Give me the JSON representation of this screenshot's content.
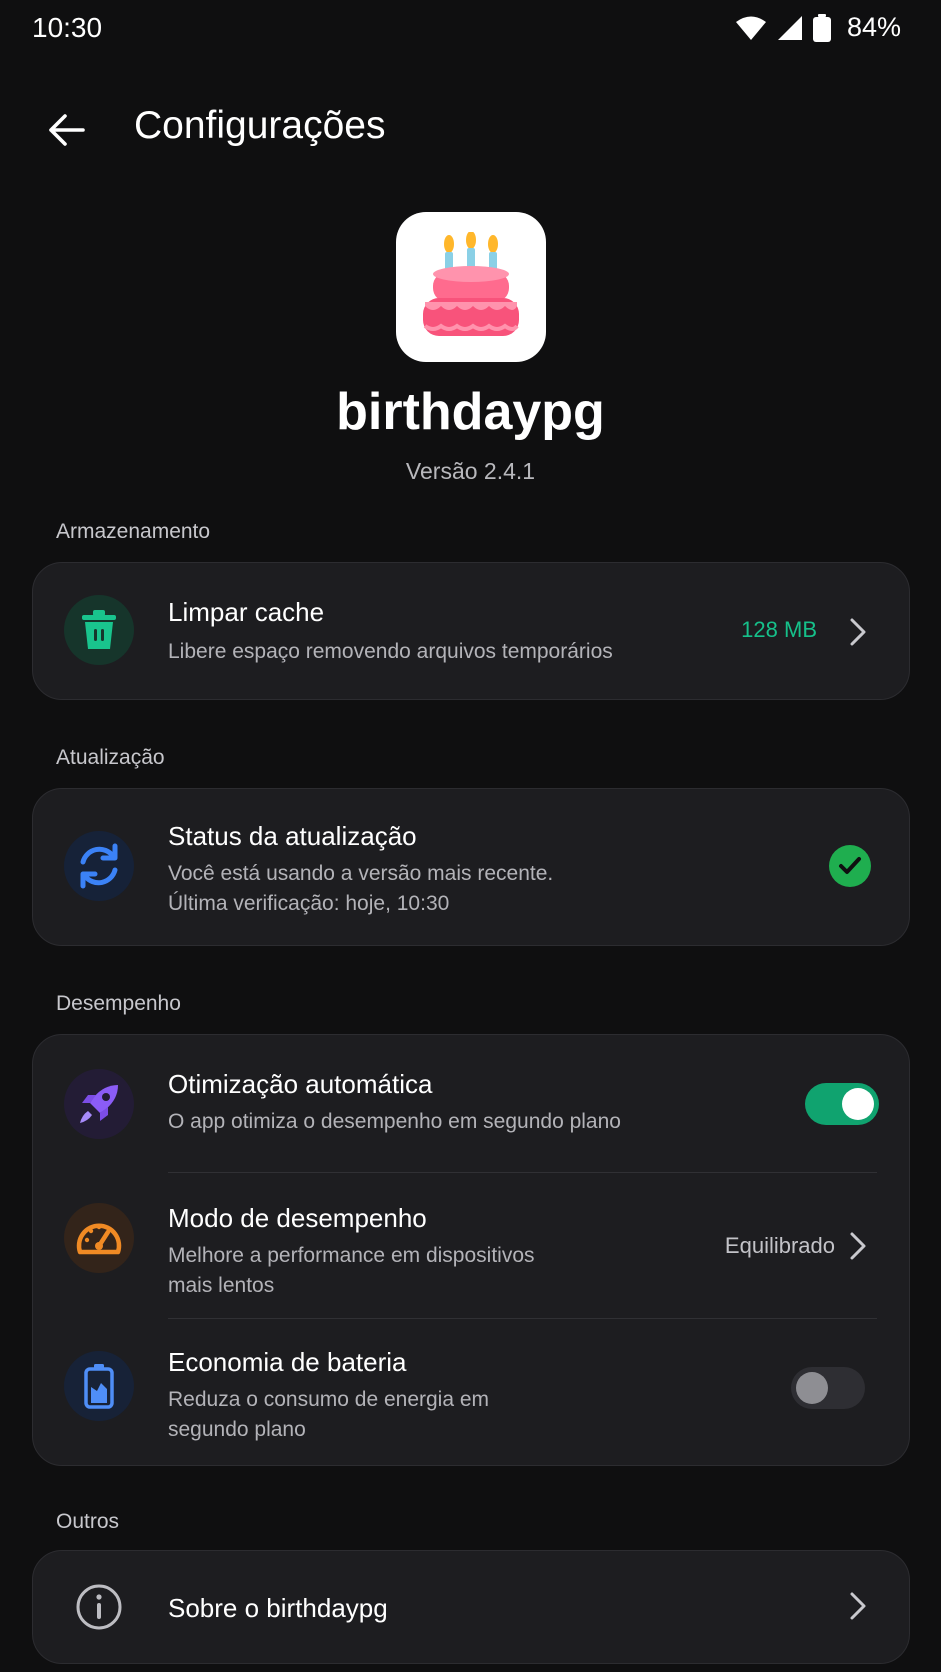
{
  "status_bar": {
    "time": "10:30",
    "battery": "84%"
  },
  "header": {
    "title": "Configurações"
  },
  "app": {
    "name": "birthdaypg",
    "version": "Versão 2.4.1"
  },
  "sections": {
    "storage": {
      "label": "Armazenamento",
      "clear_cache": {
        "title": "Limpar cache",
        "subtitle": "Libere espaço removendo arquivos temporários",
        "value": "128 MB"
      }
    },
    "update": {
      "label": "Atualização",
      "status": {
        "title": "Status da atualização",
        "line1": "Você está usando a versão mais recente.",
        "line2": "Última verificação: hoje, 10:30"
      }
    },
    "performance": {
      "label": "Desempenho",
      "auto_opt": {
        "title": "Otimização automática",
        "subtitle": "O app otimiza o desempenho em segundo plano",
        "enabled": true
      },
      "mode": {
        "title": "Modo de desempenho",
        "line1": "Melhore a performance em dispositivos",
        "line2": "mais lentos",
        "value": "Equilibrado"
      },
      "battery": {
        "title": "Economia de bateria",
        "line1": "Reduza o consumo de energia em",
        "line2": "segundo plano",
        "enabled": false
      }
    },
    "others": {
      "label": "Outros",
      "about": {
        "title": "Sobre o birthdaypg"
      }
    }
  },
  "colors": {
    "accent_green": "#16c08a",
    "toggle_on": "#10a36f",
    "check_green": "#1fae4f",
    "update_blue": "#3b82f6",
    "rocket_purple": "#8b5cf6",
    "gauge_orange": "#f08a24",
    "battery_blue": "#4f8ef7"
  },
  "icons": [
    "back-arrow-icon",
    "trash-icon",
    "sync-icon",
    "check-icon",
    "rocket-icon",
    "speedometer-icon",
    "battery-icon",
    "info-icon",
    "chevron-right-icon",
    "wifi-icon",
    "signal-icon",
    "battery-status-icon",
    "birthday-cake-icon"
  ]
}
